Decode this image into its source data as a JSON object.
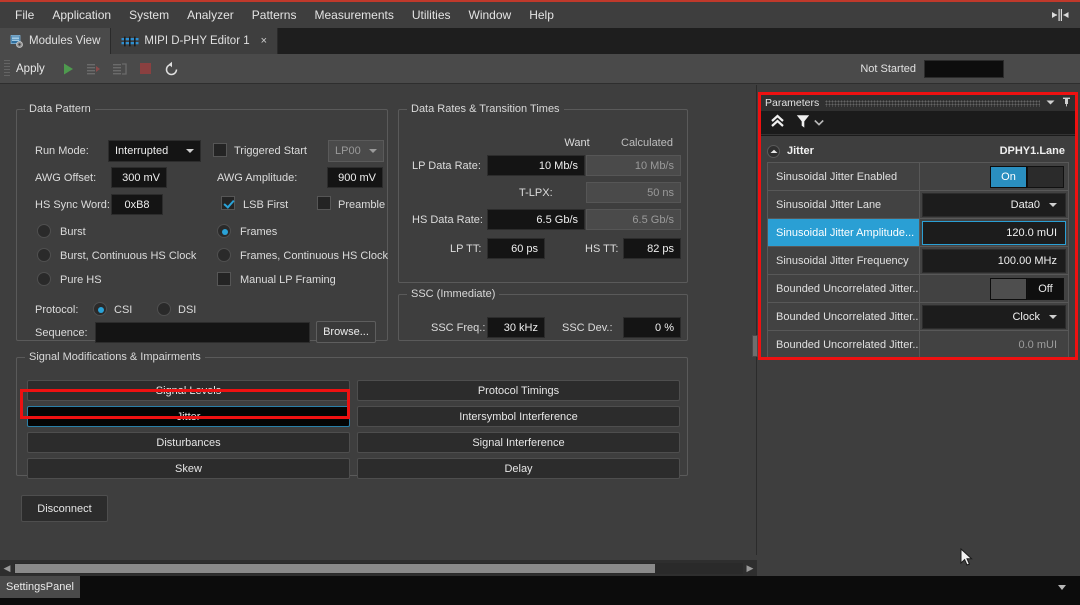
{
  "menu": {
    "items": [
      "File",
      "Application",
      "System",
      "Analyzer",
      "Patterns",
      "Measurements",
      "Utilities",
      "Window",
      "Help"
    ],
    "split_icon": "split-horizontal-icon"
  },
  "tabs": [
    {
      "label": "Modules View",
      "icon": "modules-view-icon",
      "active": false,
      "closable": false
    },
    {
      "label": "MIPI D-PHY Editor 1",
      "icon": "mipi-editor-icon",
      "active": true,
      "closable": true,
      "close_glyph": "×"
    }
  ],
  "toolbar": {
    "apply_label": "Apply",
    "buttons": [
      "run-icon",
      "step-forward-icon",
      "step-into-icon",
      "stop-icon",
      "reset-icon"
    ],
    "status_label": "Not Started",
    "status_value": ""
  },
  "data_pattern": {
    "title": "Data Pattern",
    "run_mode_label": "Run Mode:",
    "run_mode_value": "Interrupted",
    "triggered_start_label": "Triggered Start",
    "triggered_start_checked": false,
    "lp_state_value": "LP00",
    "awg_offset_label": "AWG Offset:",
    "awg_offset_value": "300 mV",
    "awg_amplitude_label": "AWG Amplitude:",
    "awg_amplitude_value": "900 mV",
    "hs_sync_word_label": "HS Sync Word:",
    "hs_sync_word_value": "0xB8",
    "lsb_first_label": "LSB First",
    "lsb_first_checked": true,
    "preamble_label": "Preamble",
    "preamble_checked": false,
    "modes": [
      {
        "label": "Burst",
        "selected": false
      },
      {
        "label": "Frames",
        "selected": true
      },
      {
        "label": "Burst, Continuous HS Clock",
        "selected": false
      },
      {
        "label": "Frames, Continuous HS Clock",
        "selected": false
      },
      {
        "label": "Pure HS",
        "selected": false
      }
    ],
    "manual_lp_framing_label": "Manual LP Framing",
    "manual_lp_framing_checked": false,
    "protocol_label": "Protocol:",
    "protocol_csi": "CSI",
    "protocol_dsi": "DSI",
    "protocol_selected": "CSI",
    "sequence_label": "Sequence:",
    "sequence_value": "",
    "browse_label": "Browse..."
  },
  "data_rates": {
    "title": "Data Rates & Transition Times",
    "col_want": "Want",
    "col_calculated": "Calculated",
    "rows": [
      {
        "label": "LP Data Rate:",
        "want": "10 Mb/s",
        "calculated": "10 Mb/s"
      },
      {
        "label": "T-LPX:",
        "want": null,
        "calculated": "50 ns"
      },
      {
        "label": "HS Data Rate:",
        "want": "6.5 Gb/s",
        "calculated": "6.5 Gb/s"
      }
    ],
    "lp_tt_label": "LP TT:",
    "lp_tt_value": "60 ps",
    "hs_tt_label": "HS TT:",
    "hs_tt_value": "82 ps"
  },
  "ssc": {
    "title": "SSC (Immediate)",
    "freq_label": "SSC Freq.:",
    "freq_value": "30 kHz",
    "dev_label": "SSC Dev.:",
    "dev_value": "0 %"
  },
  "impairments": {
    "title": "Signal Modifications & Impairments",
    "left": [
      {
        "label": "Signal Levels",
        "selected": false
      },
      {
        "label": "Jitter",
        "selected": true
      },
      {
        "label": "Disturbances",
        "selected": false
      },
      {
        "label": "Skew",
        "selected": false
      }
    ],
    "right": [
      {
        "label": "Protocol Timings",
        "selected": false
      },
      {
        "label": "Intersymbol Interference",
        "selected": false
      },
      {
        "label": "Signal Interference",
        "selected": false
      },
      {
        "label": "Delay",
        "selected": false
      }
    ],
    "disconnect_label": "Disconnect"
  },
  "parameters_dock": {
    "title": "Parameters",
    "collapse_icon": "collapse-all-icon",
    "filter_icon": "filter-icon",
    "filter_caret_icon": "chevron-down-icon",
    "menu_icon": "chevron-down-icon",
    "pin_icon": "pin-icon",
    "group_title": "Jitter",
    "group_expander_icon": "collapse-icon",
    "group_scope": "DPHY1.Lane",
    "rows": [
      {
        "name": "Sinusoidal Jitter Enabled",
        "type": "toggle",
        "value": "On",
        "state": "on",
        "selected": false,
        "readonly": false
      },
      {
        "name": "Sinusoidal Jitter Lane",
        "type": "combo",
        "value": "Data0",
        "selected": false,
        "readonly": false
      },
      {
        "name": "Sinusoidal Jitter Amplitude...",
        "type": "text",
        "value": "120.0 mUI",
        "selected": true,
        "readonly": false
      },
      {
        "name": "Sinusoidal Jitter Frequency",
        "type": "text",
        "value": "100.00 MHz",
        "selected": false,
        "readonly": false
      },
      {
        "name": "Bounded Uncorrelated Jitter...",
        "type": "toggle",
        "value": "Off",
        "state": "off",
        "selected": false,
        "readonly": false
      },
      {
        "name": "Bounded Uncorrelated Jitter...",
        "type": "combo",
        "value": "Clock",
        "selected": false,
        "readonly": false
      },
      {
        "name": "Bounded Uncorrelated Jitter...",
        "type": "text",
        "value": "0.0 mUI",
        "selected": false,
        "readonly": true
      }
    ]
  },
  "statusbar": {
    "panel_label": "SettingsPanel",
    "caret_icon": "chevron-down-icon"
  },
  "colors": {
    "accent_blue": "#2a9fd4",
    "highlight_red": "#ee1111",
    "window_bg": "#3e3e3e",
    "field_bg": "#141414",
    "toolbar_bg": "#4a4a4a"
  }
}
